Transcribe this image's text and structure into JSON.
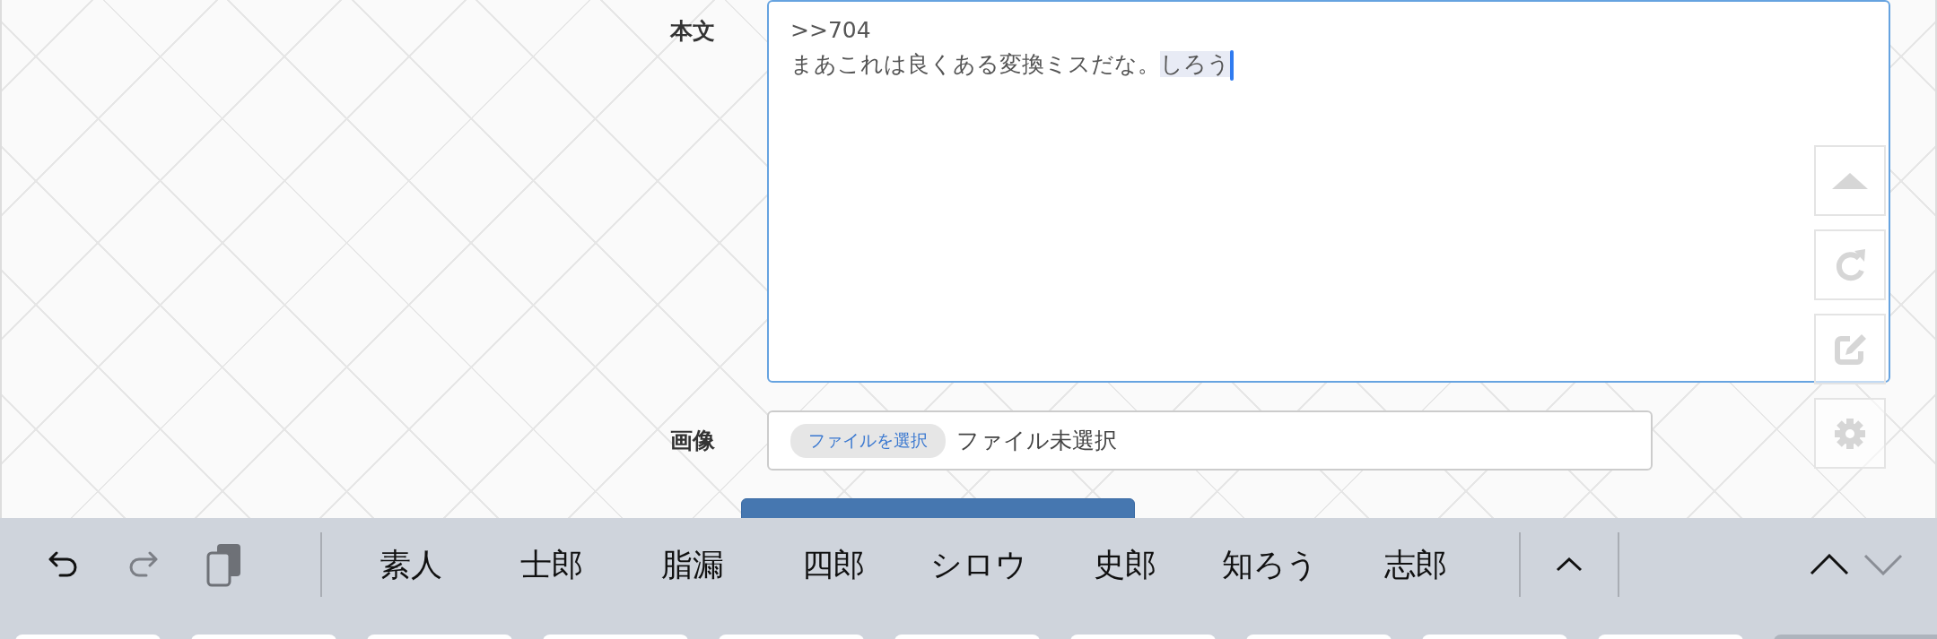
{
  "form": {
    "body": {
      "label": "本文",
      "lines": [
        ">>704",
        "まあこれは良くある変換ミスだな。"
      ],
      "composing": "しろう"
    },
    "image": {
      "label": "画像",
      "button": "ファイルを選択",
      "status": "ファイル未選択"
    }
  },
  "keyboard_bar": {
    "candidates": [
      "素人",
      "士郎",
      "脂漏",
      "四郎",
      "シロウ",
      "史郎",
      "知ろう",
      "志郎"
    ]
  }
}
